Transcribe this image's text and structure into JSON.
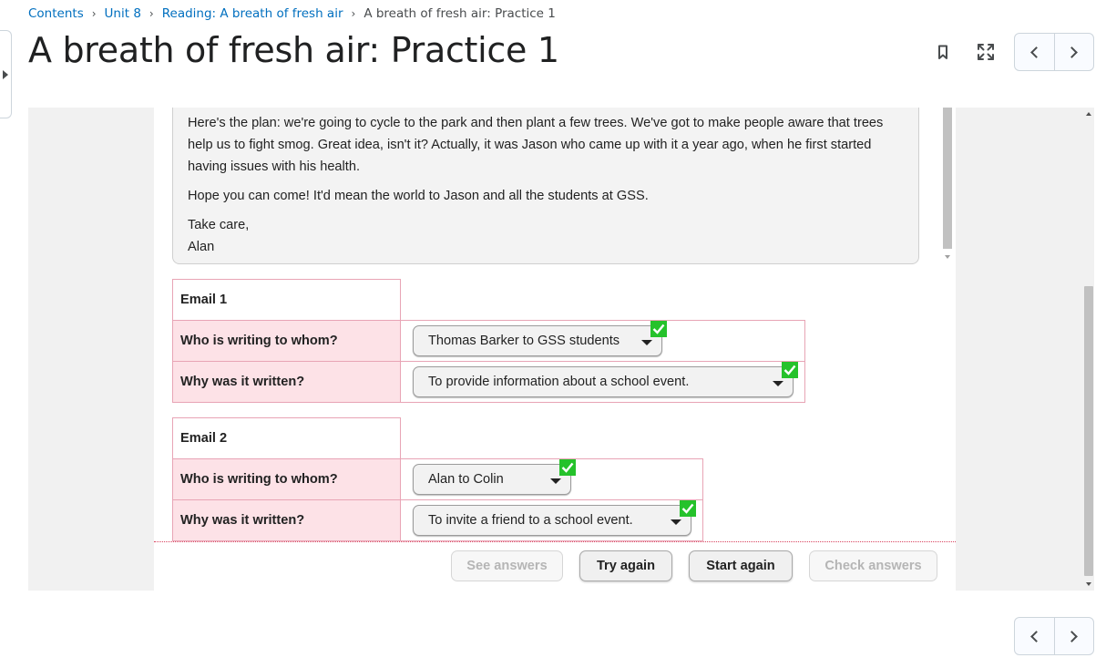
{
  "breadcrumb": {
    "items": [
      "Contents",
      "Unit 8",
      "Reading: A breath of fresh air"
    ],
    "current": "A breath of fresh air: Practice 1"
  },
  "page_title": "A breath of fresh air: Practice 1",
  "toolbar": {
    "icons": [
      "bookmark-icon",
      "fullscreen-icon",
      "chevron-left-icon",
      "chevron-right-icon"
    ]
  },
  "letter": {
    "paragraph1": "Here's the plan: we're going to cycle to the park and then plant a few trees. We've got to make people aware that trees help us to fight smog. Great idea, isn't it? Actually, it was Jason who came up with it a year ago, when he first started having issues with his health.",
    "paragraph2": "Hope you can come! It'd mean the world to Jason and all the students at GSS.",
    "closing": "Take care,",
    "signature": "Alan"
  },
  "emails": [
    {
      "title": "Email 1",
      "q1_label": "Who is writing to whom?",
      "q1_answer": "Thomas Barker to GSS students",
      "q2_label": "Why was it written?",
      "q2_answer": "To provide information about a school event."
    },
    {
      "title": "Email 2",
      "q1_label": "Who is writing to whom?",
      "q1_answer": "Alan to Colin",
      "q2_label": "Why was it written?",
      "q2_answer": "To invite a friend to a school event."
    }
  ],
  "buttons": {
    "see_answers": "See answers",
    "try_again": "Try again",
    "start_again": "Start again",
    "check_answers": "Check answers"
  },
  "colors": {
    "link": "#006fbf",
    "correct": "#25c22b",
    "label_bg": "#fde2e7",
    "border_accent": "#e8a4b5"
  }
}
